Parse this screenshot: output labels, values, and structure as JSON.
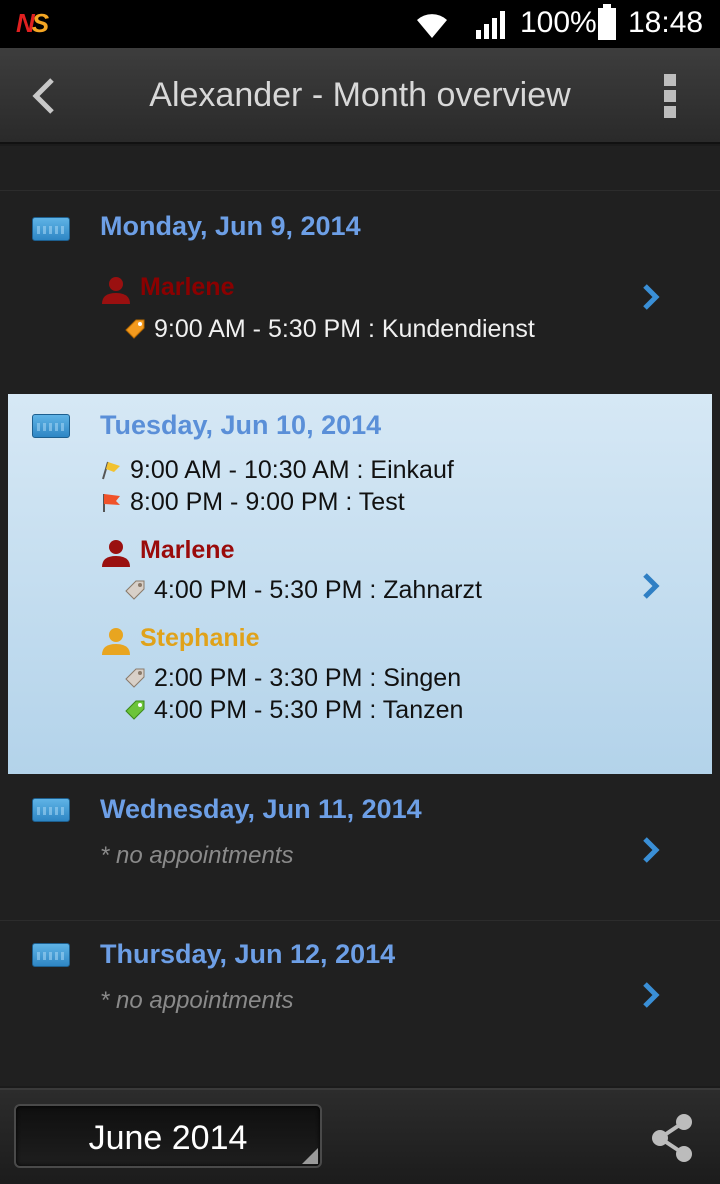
{
  "statusbar": {
    "app_icon": "NS",
    "battery": "100%",
    "time": "18:48"
  },
  "actionbar": {
    "title": "Alexander - Month overview"
  },
  "days": [
    {
      "title": "Monday, Jun 9, 2014",
      "persons": [
        {
          "name": "Marlene",
          "color": "#8b0000",
          "appointments": [
            {
              "text": "9:00 AM - 5:30 PM : Kundendienst",
              "icon": "orange-tag-icon"
            }
          ]
        }
      ]
    },
    {
      "title": "Tuesday, Jun 10, 2014",
      "own": [
        {
          "text": "9:00 AM - 10:30 AM : Einkauf",
          "icon": "yellow-flag-icon"
        },
        {
          "text": "8:00 PM - 9:00 PM : Test",
          "icon": "red-flag-icon"
        }
      ],
      "persons": [
        {
          "name": "Marlene",
          "color": "#9a0b0b",
          "appointments": [
            {
              "text": "4:00 PM - 5:30 PM : Zahnarzt",
              "icon": "grey-tag-icon"
            }
          ]
        },
        {
          "name": "Stephanie",
          "color": "#e0a21a",
          "appointments": [
            {
              "text": "2:00 PM - 3:30 PM : Singen",
              "icon": "grey-tag-icon"
            },
            {
              "text": "4:00 PM - 5:30 PM : Tanzen",
              "icon": "green-tag-icon"
            }
          ]
        }
      ]
    },
    {
      "title": "Wednesday, Jun 11, 2014",
      "empty": "* no appointments"
    },
    {
      "title": "Thursday, Jun 12, 2014",
      "empty": "* no appointments"
    }
  ],
  "bottombar": {
    "month_label": "June 2014"
  },
  "colors": {
    "day_title": "#6d9fe6",
    "selected_bg": "#c5def0",
    "chevron": "#3a8fd6"
  }
}
